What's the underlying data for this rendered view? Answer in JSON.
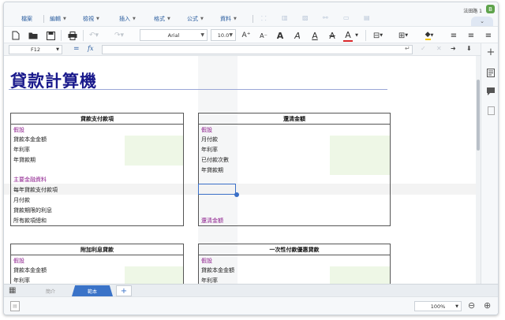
{
  "user": {
    "name": "法田路 1",
    "badge": "B"
  },
  "menu": {
    "items": [
      "檔案",
      "編輯",
      "檢視",
      "插入",
      "格式",
      "公式",
      "資料"
    ],
    "collapse_glyph": "⌄"
  },
  "toolbar": {
    "font_name": "Arial",
    "font_size": "10.0",
    "glyph_grow": "A⁺",
    "glyph_shrink": "A⁻",
    "glyph_bold": "A",
    "glyph_italic": "A",
    "glyph_underline": "A",
    "glyph_strike": "A",
    "glyph_color": "A"
  },
  "formula_bar": {
    "cell_ref": "F12",
    "equals": "=",
    "fx": "fx",
    "value": ""
  },
  "sheet": {
    "title": "貸款計算機",
    "panels": {
      "loan_payment": {
        "header": "貸款支付款項",
        "assumptions_label": "假設",
        "rows": [
          "貸款本金金額",
          "年利率",
          "年貸款期"
        ],
        "main_label": "主要金融資料",
        "main_rows": [
          "每年貸款支付款項",
          "月付款",
          "貸款期限的利息",
          "所有款項總和"
        ]
      },
      "payoff": {
        "header": "還清金額",
        "assumptions_label": "假設",
        "rows": [
          "月付款",
          "年利率",
          "已付款次數",
          "年貸款期"
        ],
        "result_label": "還清金額"
      },
      "extra_interest": {
        "header": "附加利息貸款",
        "assumptions_label": "假設",
        "rows": [
          "貸款本金金額",
          "年利率"
        ]
      },
      "lump_sum": {
        "header": "一次性付款優惠貸款",
        "assumptions_label": "假設",
        "rows": [
          "貸款本金金額",
          "年利率"
        ]
      }
    }
  },
  "tabs": {
    "items": [
      {
        "label": "簡介",
        "active": false
      },
      {
        "label": "範本",
        "active": true
      }
    ],
    "add_label": "+"
  },
  "status": {
    "zoom": "100%"
  },
  "colors": {
    "accent": "#3a73c8",
    "title": "#1a1a8c",
    "highlight_label": "#8b1a8b",
    "input_fill": "#eef7e6"
  }
}
